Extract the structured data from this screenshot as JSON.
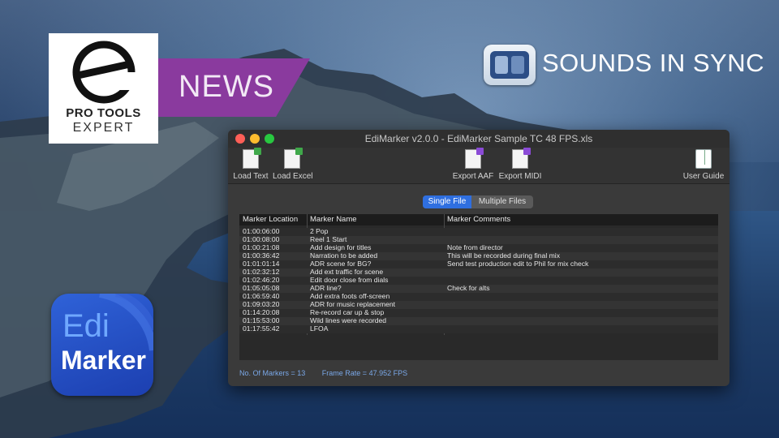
{
  "branding": {
    "pte_line1": "PRO TOOLS",
    "pte_line2": "EXPERT",
    "news": "NEWS",
    "sounds_in_sync": "SOUNDS IN SYNC",
    "app_icon_line1": "Edi",
    "app_icon_line2": "Marker"
  },
  "window": {
    "title": "EdiMarker v2.0.0 - EdiMarker Sample TC 48 FPS.xls"
  },
  "toolbar": {
    "load_text": "Load Text",
    "load_excel": "Load Excel",
    "export_aaf": "Export AAF",
    "export_midi": "Export MIDI",
    "user_guide": "User Guide",
    "aaf_badge": "AAF",
    "midi_badge": "MIDI"
  },
  "tabs": {
    "single": "Single File",
    "multiple": "Multiple Files",
    "active": "Single File"
  },
  "table": {
    "headers": [
      "Marker Location",
      "Marker Name",
      "Marker Comments"
    ],
    "rows": [
      [
        "01:00:06:00",
        "2 Pop",
        ""
      ],
      [
        "01:00:08:00",
        "Reel 1 Start",
        ""
      ],
      [
        "01:00:21:08",
        "Add design for titles",
        "Note from director"
      ],
      [
        "01:00:36:42",
        "Narration to be added",
        "This will be recorded during final mix"
      ],
      [
        "01:01:01:14",
        "ADR scene for BG?",
        "Send test production edit to Phil for mix check"
      ],
      [
        "01:02:32:12",
        "Add ext traffic for scene",
        ""
      ],
      [
        "01:02:46:20",
        "Edit door close from dials",
        ""
      ],
      [
        "01:05:05:08",
        "ADR line?",
        "Check for alts"
      ],
      [
        "01:06:59:40",
        "Add extra foots off-screen",
        ""
      ],
      [
        "01:09:03:20",
        "ADR for music replacement",
        ""
      ],
      [
        "01:14:20:08",
        "Re-record car up & stop",
        ""
      ],
      [
        "01:15:53:00",
        "Wild lines were recorded",
        ""
      ],
      [
        "01:17:55:42",
        "LFOA",
        ""
      ]
    ]
  },
  "status": {
    "markers": "No. Of Markers = 13",
    "frame_rate": "Frame Rate = 47.952 FPS"
  },
  "colors": {
    "news_purple": "#8a3a9e",
    "accent_blue": "#2f6fe0",
    "status_blue": "#7aa8e8"
  }
}
